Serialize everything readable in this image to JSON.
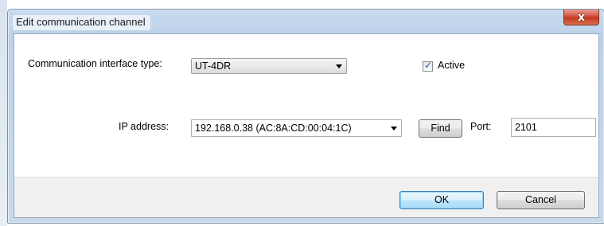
{
  "window": {
    "title": "Edit communication channel",
    "close_glyph": "x"
  },
  "form": {
    "interface_type_label": "Communication interface type:",
    "interface_type_value": "UT-4DR",
    "active_label": "Active",
    "active_checked": true,
    "ip_label": "IP address:",
    "ip_value": "192.168.0.38 (AC:8A:CD:00:04:1C)",
    "find_label": "Find",
    "port_label": "Port:",
    "port_value": "2101"
  },
  "footer": {
    "ok_label": "OK",
    "cancel_label": "Cancel"
  },
  "icons": {
    "close": "close-icon",
    "dropdown": "chevron-down-icon",
    "check": "checkmark-icon"
  }
}
